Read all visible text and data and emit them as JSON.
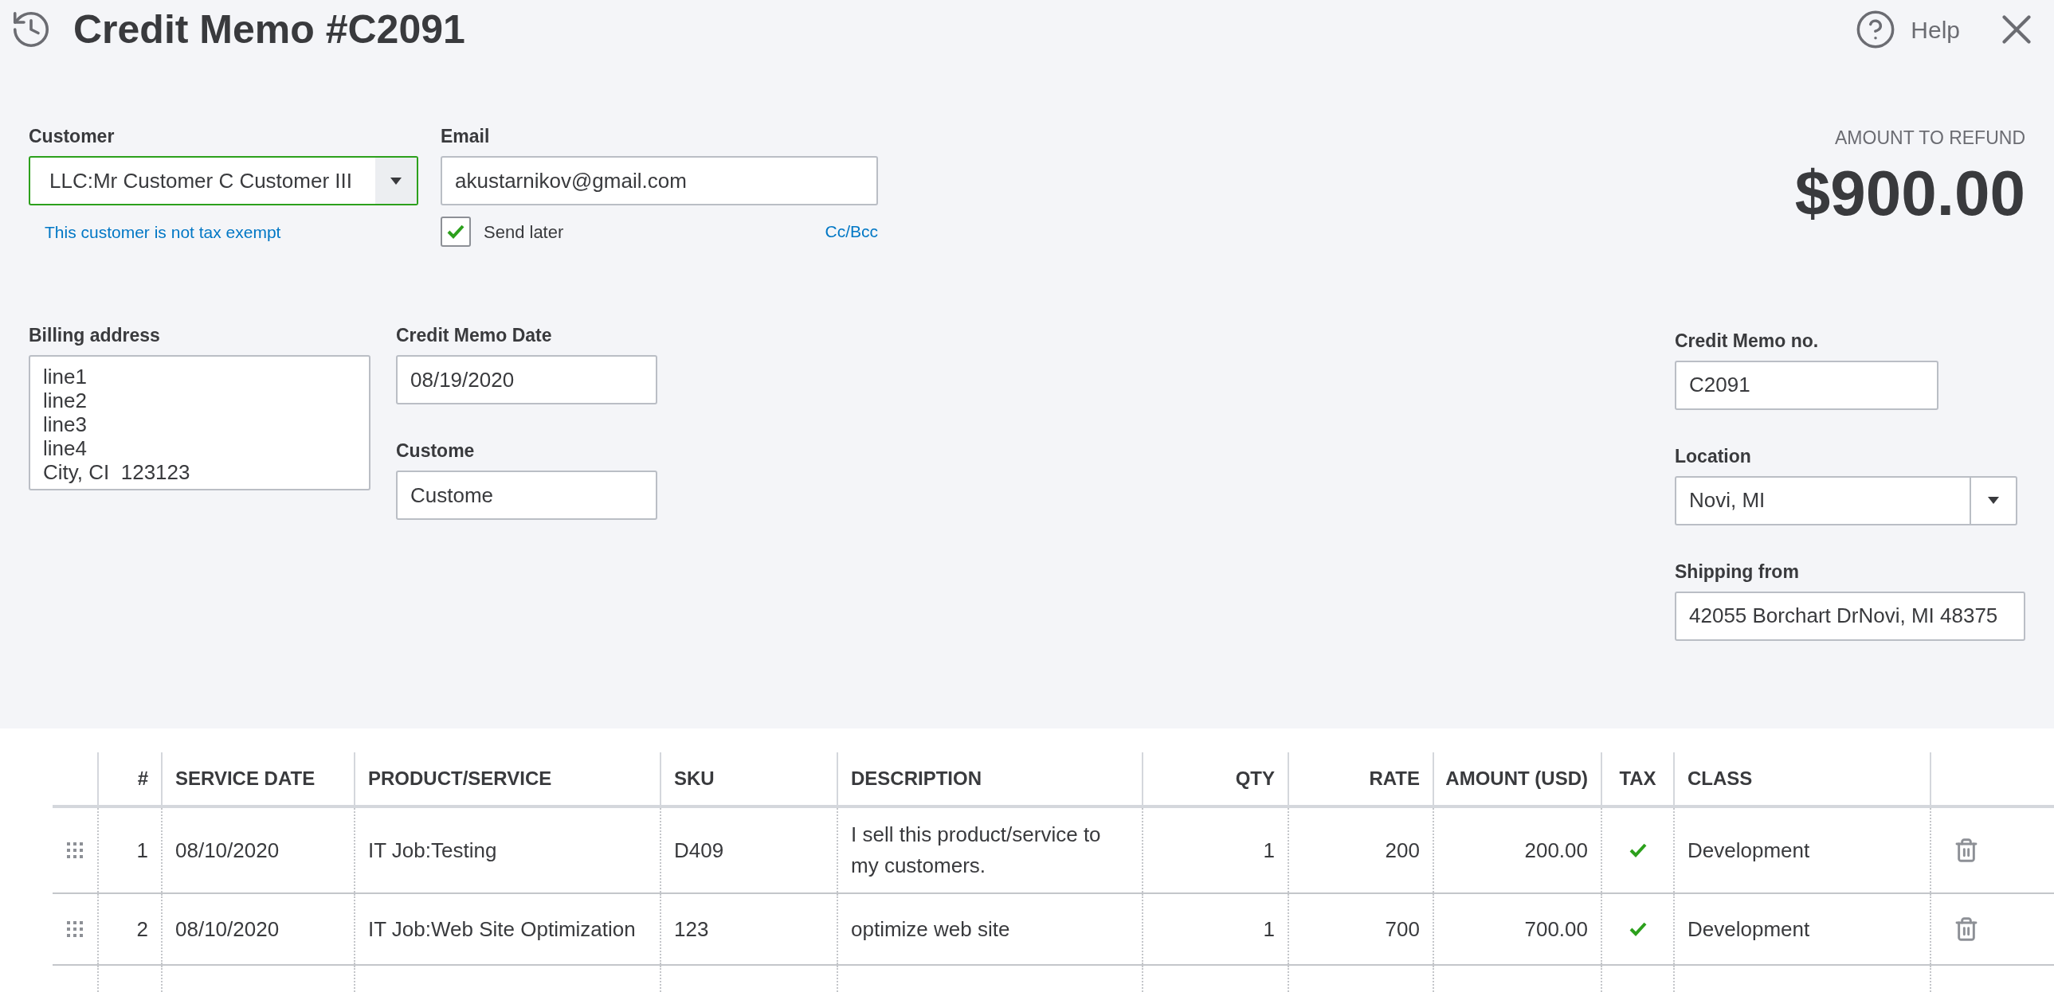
{
  "header": {
    "title": "Credit Memo #C2091",
    "help": "Help"
  },
  "customer": {
    "label": "Customer",
    "value": "LLC:Mr Customer C Customer III",
    "note": "This customer is not tax exempt"
  },
  "email": {
    "label": "Email",
    "value": "akustarnikov@gmail.com",
    "cc_bcc": "Cc/Bcc"
  },
  "send_later": {
    "label": "Send later",
    "checked": true
  },
  "amount": {
    "label": "AMOUNT TO REFUND",
    "value": "$900.00"
  },
  "billing_address": {
    "label": "Billing address",
    "value": "line1\nline2\nline3\nline4\nCity, CI  123123"
  },
  "credit_memo_date": {
    "label": "Credit Memo Date",
    "value": "08/19/2020"
  },
  "custome": {
    "label": "Custome",
    "value": "Custome"
  },
  "credit_memo_no": {
    "label": "Credit Memo no.",
    "value": "C2091"
  },
  "location": {
    "label": "Location",
    "value": "Novi, MI"
  },
  "shipping_from": {
    "label": "Shipping from",
    "value": "42055 Borchart DrNovi, MI  48375"
  },
  "table": {
    "columns": [
      "#",
      "SERVICE DATE",
      "PRODUCT/SERVICE",
      "SKU",
      "DESCRIPTION",
      "QTY",
      "RATE",
      "AMOUNT (USD)",
      "TAX",
      "CLASS"
    ],
    "rows": [
      {
        "number": "1",
        "service_date": "08/10/2020",
        "product": "IT Job:Testing",
        "sku": "D409",
        "description": "I sell this product/service to my customers.",
        "qty": "1",
        "rate": "200",
        "amount": "200.00",
        "tax": true,
        "class": "Development"
      },
      {
        "number": "2",
        "service_date": "08/10/2020",
        "product": "IT Job:Web Site Optimization",
        "sku": "123",
        "description": "optimize web site",
        "qty": "1",
        "rate": "700",
        "amount": "700.00",
        "tax": true,
        "class": "Development"
      }
    ]
  }
}
